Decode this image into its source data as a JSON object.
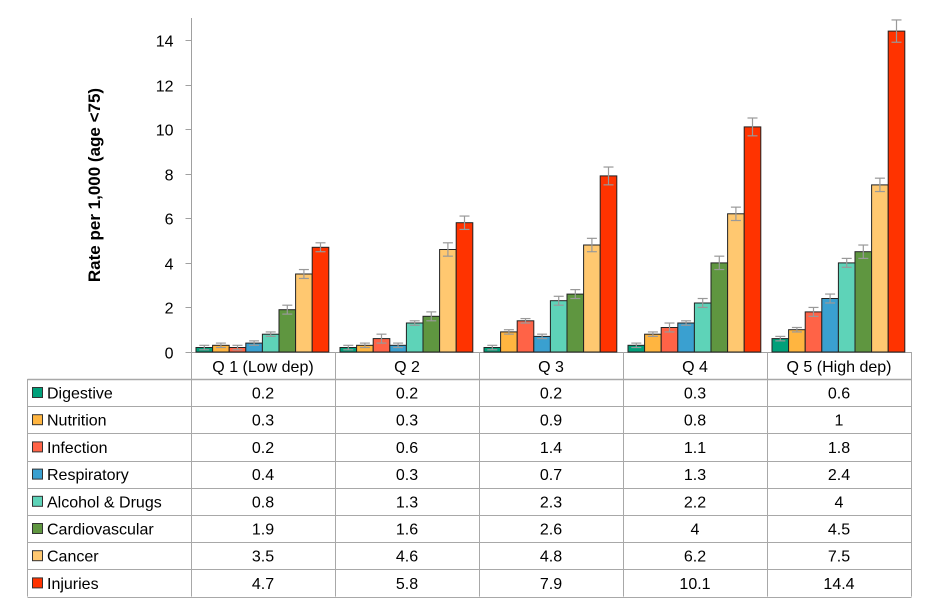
{
  "chart_data": {
    "type": "bar",
    "title": "",
    "xlabel": "",
    "ylabel": "Rate per 1,000 (age <75)",
    "ylim": [
      0,
      15
    ],
    "yticks": [
      0,
      2,
      4,
      6,
      8,
      10,
      12,
      14
    ],
    "grid": false,
    "legend": "data-table-left",
    "error_bars": true,
    "categories": [
      "Q 1 (Low dep)",
      "Q 2",
      "Q 3",
      "Q 4",
      "Q 5 (High dep)"
    ],
    "series": [
      {
        "name": "Digestive",
        "color": "#00A07A",
        "values": [
          0.2,
          0.2,
          0.2,
          0.3,
          0.6
        ],
        "labels": [
          "0.2",
          "0.2",
          "0.2",
          "0.3",
          "0.6"
        ]
      },
      {
        "name": "Nutrition",
        "color": "#FFB540",
        "values": [
          0.3,
          0.3,
          0.9,
          0.8,
          1
        ],
        "labels": [
          "0.3",
          "0.3",
          "0.9",
          "0.8",
          "1"
        ]
      },
      {
        "name": "Infection",
        "color": "#FF6347",
        "values": [
          0.2,
          0.6,
          1.4,
          1.1,
          1.8
        ],
        "labels": [
          "0.2",
          "0.6",
          "1.4",
          "1.1",
          "1.8"
        ]
      },
      {
        "name": "Respiratory",
        "color": "#3AA0D0",
        "values": [
          0.4,
          0.3,
          0.7,
          1.3,
          2.4
        ],
        "labels": [
          "0.4",
          "0.3",
          "0.7",
          "1.3",
          "2.4"
        ]
      },
      {
        "name": "Alcohol & Drugs",
        "color": "#5ED3B8",
        "values": [
          0.8,
          1.3,
          2.3,
          2.2,
          4
        ],
        "labels": [
          "0.8",
          "1.3",
          "2.3",
          "2.2",
          "4"
        ]
      },
      {
        "name": "Cardiovascular",
        "color": "#5F9640",
        "values": [
          1.9,
          1.6,
          2.6,
          4,
          4.5
        ],
        "labels": [
          "1.9",
          "1.6",
          "2.6",
          "4",
          "4.5"
        ]
      },
      {
        "name": "Cancer",
        "color": "#FFC870",
        "values": [
          3.5,
          4.6,
          4.8,
          6.2,
          7.5
        ],
        "labels": [
          "3.5",
          "4.6",
          "4.8",
          "6.2",
          "7.5"
        ]
      },
      {
        "name": "Injuries",
        "color": "#FF3300",
        "values": [
          4.7,
          5.8,
          7.9,
          10.1,
          14.4
        ],
        "labels": [
          "4.7",
          "5.8",
          "7.9",
          "10.1",
          "14.4"
        ]
      }
    ],
    "error_margin_approx": [
      [
        0.1,
        0.1,
        0.1,
        0.1,
        0.1
      ],
      [
        0.1,
        0.1,
        0.1,
        0.1,
        0.1
      ],
      [
        0.1,
        0.2,
        0.1,
        0.2,
        0.2
      ],
      [
        0.1,
        0.1,
        0.1,
        0.1,
        0.2
      ],
      [
        0.1,
        0.1,
        0.2,
        0.2,
        0.2
      ],
      [
        0.2,
        0.2,
        0.2,
        0.3,
        0.3
      ],
      [
        0.2,
        0.3,
        0.3,
        0.3,
        0.3
      ],
      [
        0.2,
        0.3,
        0.4,
        0.4,
        0.5
      ]
    ]
  }
}
